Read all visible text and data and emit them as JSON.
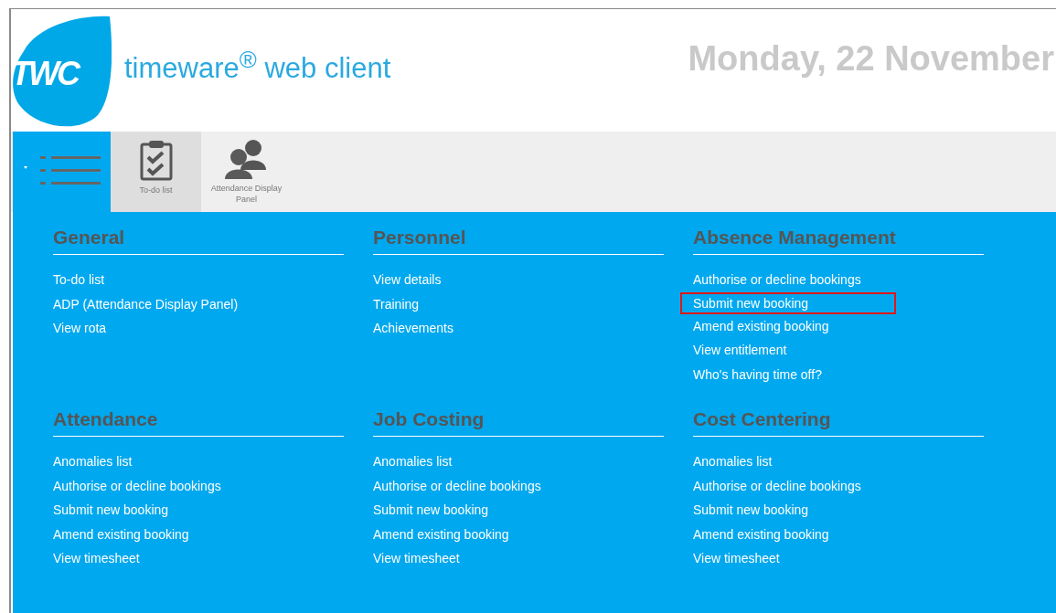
{
  "header": {
    "logo": "TWC",
    "app_name": "timeware$^{®}$ web client",
    "date": "Monday, 22 November"
  },
  "toolbar": {
    "menu_open": true,
    "items": [
      {
        "kind": "clipboard",
        "label": "To-do list",
        "selected": true
      },
      {
        "kind": "people",
        "label": "Attendance Display Panel",
        "selected": false
      }
    ]
  },
  "sections": [
    {
      "title": "General",
      "links": [
        {
          "label": "To-do list",
          "outlined": false
        },
        {
          "label": "ADP (Attendance Display Panel)",
          "outlined": false
        },
        {
          "label": "View rota",
          "outlined": false
        }
      ]
    },
    {
      "title": "Personnel",
      "links": [
        {
          "label": "View details",
          "outlined": false
        },
        {
          "label": "Training",
          "outlined": false
        },
        {
          "label": "Achievements",
          "outlined": false
        }
      ]
    },
    {
      "title": "Absence Management",
      "links": [
        {
          "label": "Authorise or decline bookings",
          "outlined": false
        },
        {
          "label": "Submit new booking",
          "outlined": true
        },
        {
          "label": "Amend existing booking",
          "outlined": false
        },
        {
          "label": "View entitlement",
          "outlined": false
        },
        {
          "label": "Who's having time off?",
          "outlined": false
        }
      ]
    },
    {
      "title": "Attendance",
      "links": [
        {
          "label": "Anomalies list",
          "outlined": false
        },
        {
          "label": "Authorise or decline bookings",
          "outlined": false
        },
        {
          "label": "Submit new booking",
          "outlined": false
        },
        {
          "label": "Amend existing booking",
          "outlined": false
        },
        {
          "label": "View timesheet",
          "outlined": false
        }
      ]
    },
    {
      "title": "Job Costing",
      "links": [
        {
          "label": "Anomalies list",
          "outlined": false
        },
        {
          "label": "Authorise or decline bookings",
          "outlined": false
        },
        {
          "label": "Submit new booking",
          "outlined": false
        },
        {
          "label": "Amend existing booking",
          "outlined": false
        },
        {
          "label": "View timesheet",
          "outlined": false
        }
      ]
    },
    {
      "title": "Cost Centering",
      "links": [
        {
          "label": "Anomalies list",
          "outlined": false
        },
        {
          "label": "Authorise or decline bookings",
          "outlined": false
        },
        {
          "label": "Submit new booking",
          "outlined": false
        },
        {
          "label": "Amend existing booking",
          "outlined": false
        },
        {
          "label": "View timesheet",
          "outlined": false
        }
      ]
    }
  ]
}
